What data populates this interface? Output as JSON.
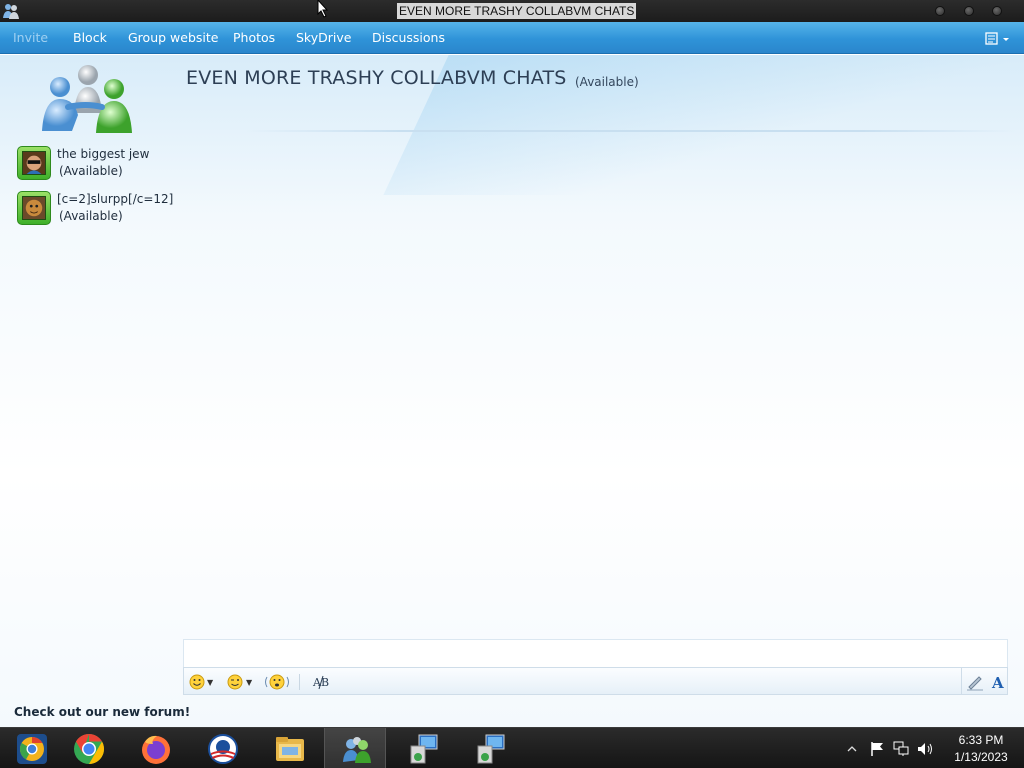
{
  "window": {
    "title": "EVEN MORE TRASHY COLLABVM CHATS"
  },
  "menu": {
    "items": [
      {
        "label": "Invite",
        "disabled": true
      },
      {
        "label": "Block"
      },
      {
        "label": "Group website"
      },
      {
        "label": "Photos"
      },
      {
        "label": "SkyDrive"
      },
      {
        "label": "Discussions"
      }
    ]
  },
  "conversation": {
    "title": "EVEN MORE TRASHY COLLABVM CHATS",
    "status": "(Available)"
  },
  "contacts": [
    {
      "name": "the biggest jew",
      "status": "(Available)"
    },
    {
      "name": "[c=2]slurpp[/c=12]",
      "status": "(Available)"
    }
  ],
  "promo": "Check out our new forum!",
  "taskbar": {
    "time": "6:33 PM",
    "date": "1/13/2023",
    "apps": [
      "chrome-canary-icon",
      "chrome-icon",
      "firefox-icon",
      "obama-logo-icon",
      "file-explorer-icon",
      "messenger-icon",
      "remote-desktop-icon",
      "remote-desktop-icon"
    ]
  },
  "colors": {
    "menubar": "#2f93d8",
    "presence_green": "#3fb02a",
    "taskbar": "#1c1c1c"
  }
}
